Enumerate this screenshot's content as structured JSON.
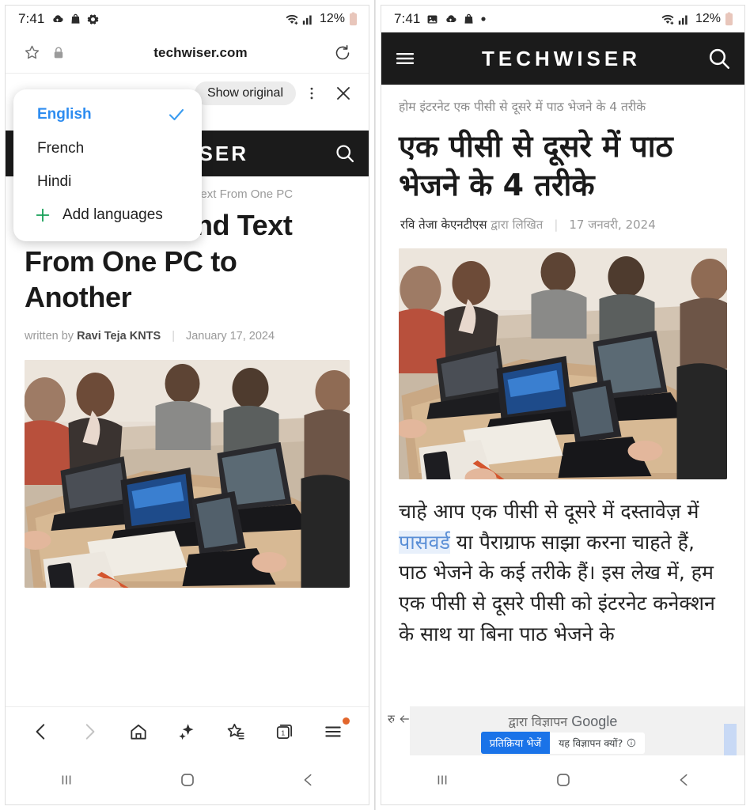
{
  "left": {
    "statusbar": {
      "time": "7:41",
      "battery_pct": "12%",
      "icons": [
        "cloud-upload-icon",
        "bag-icon",
        "gear-icon"
      ],
      "right_icons": [
        "wifi-icon",
        "signal-icon",
        "battery-icon"
      ]
    },
    "urlbar": {
      "star_icon": "star-icon",
      "lock_icon": "lock-icon",
      "url": "techwiser.com",
      "reload_icon": "reload-icon"
    },
    "translatebar": {
      "show_original_label": "Show original",
      "more_icon": "more-vertical-icon",
      "close_icon": "close-icon"
    },
    "language_menu": {
      "items": [
        {
          "label": "English",
          "selected": true
        },
        {
          "label": "French",
          "selected": false
        },
        {
          "label": "Hindi",
          "selected": false
        }
      ],
      "add_label": "Add languages",
      "check_icon": "check-icon",
      "plus_icon": "plus-icon",
      "accent": "#2d8cf0",
      "plus_color": "#18a058"
    },
    "site_header": {
      "brand": "TECHWISER",
      "search_icon": "search-icon"
    },
    "article": {
      "breadcrumb": "Send Text From One PC",
      "headline": "4 Ways to Send Text From One PC to Another",
      "written_by_label": "written by",
      "author": "Ravi Teja KNTS",
      "separator": "|",
      "date": "January 17, 2024",
      "hero_alt": "people-with-laptops-photo"
    },
    "toolbar": {
      "items": [
        {
          "name": "back-icon",
          "enabled": true
        },
        {
          "name": "forward-icon",
          "enabled": false
        },
        {
          "name": "home-icon",
          "enabled": true
        },
        {
          "name": "sparkle-icon",
          "enabled": true
        },
        {
          "name": "bookmarks-icon",
          "enabled": true
        },
        {
          "name": "tabs-icon",
          "enabled": true,
          "count": "1"
        },
        {
          "name": "menu-icon",
          "enabled": true,
          "badge": true
        }
      ],
      "badge_color": "#e2662c"
    },
    "androidnav": [
      "recents-icon",
      "home-icon",
      "back-icon"
    ]
  },
  "right": {
    "statusbar": {
      "time": "7:41",
      "battery_pct": "12%",
      "icons": [
        "image-icon",
        "cloud-upload-icon",
        "bag-icon",
        "dot-icon"
      ],
      "right_icons": [
        "wifi-icon",
        "signal-icon",
        "battery-icon"
      ]
    },
    "site_header": {
      "menu_icon": "hamburger-icon",
      "brand": "TECHWISER",
      "search_icon": "search-icon"
    },
    "article": {
      "breadcrumb": "होम इंटरनेट एक पीसी से दूसरे में पाठ भेजने के 4 तरीके",
      "headline": "एक पीसी से दूसरे में पाठ भेजने के 4 तरीके",
      "author": "रवि तेजा केएनटीएस",
      "written_by_label": "द्वारा लिखित",
      "separator": "|",
      "date": "17 जनवरी, 2024",
      "hero_alt": "people-with-laptops-photo",
      "body_part1": "चाहे आप एक पीसी से दूसरे में दस्तावेज़ में ",
      "body_link": "पासवर्ड",
      "body_part2": " या पैराग्राफ साझा करना चाहते हैं, पाठ भेजने के कई तरीके हैं। इस लेख में, हम एक पीसी से दूसरे पीसी को इंटरनेट कनेक्शन के साथ या बिना पाठ भेजने के",
      "link_color": "#5b8fd6"
    },
    "ad": {
      "by_label": "द्वारा विज्ञापन",
      "google_label": "Google",
      "feedback_button": "प्रतिक्रिया भेजें",
      "why_label": "यह विज्ञापन क्यों?",
      "info_icon": "info-icon",
      "back_icon": "ad-back-arrow-icon",
      "devanagari_mark": "रु",
      "button_color": "#1a73e8"
    },
    "androidnav": [
      "recents-icon",
      "home-icon",
      "back-icon"
    ]
  }
}
